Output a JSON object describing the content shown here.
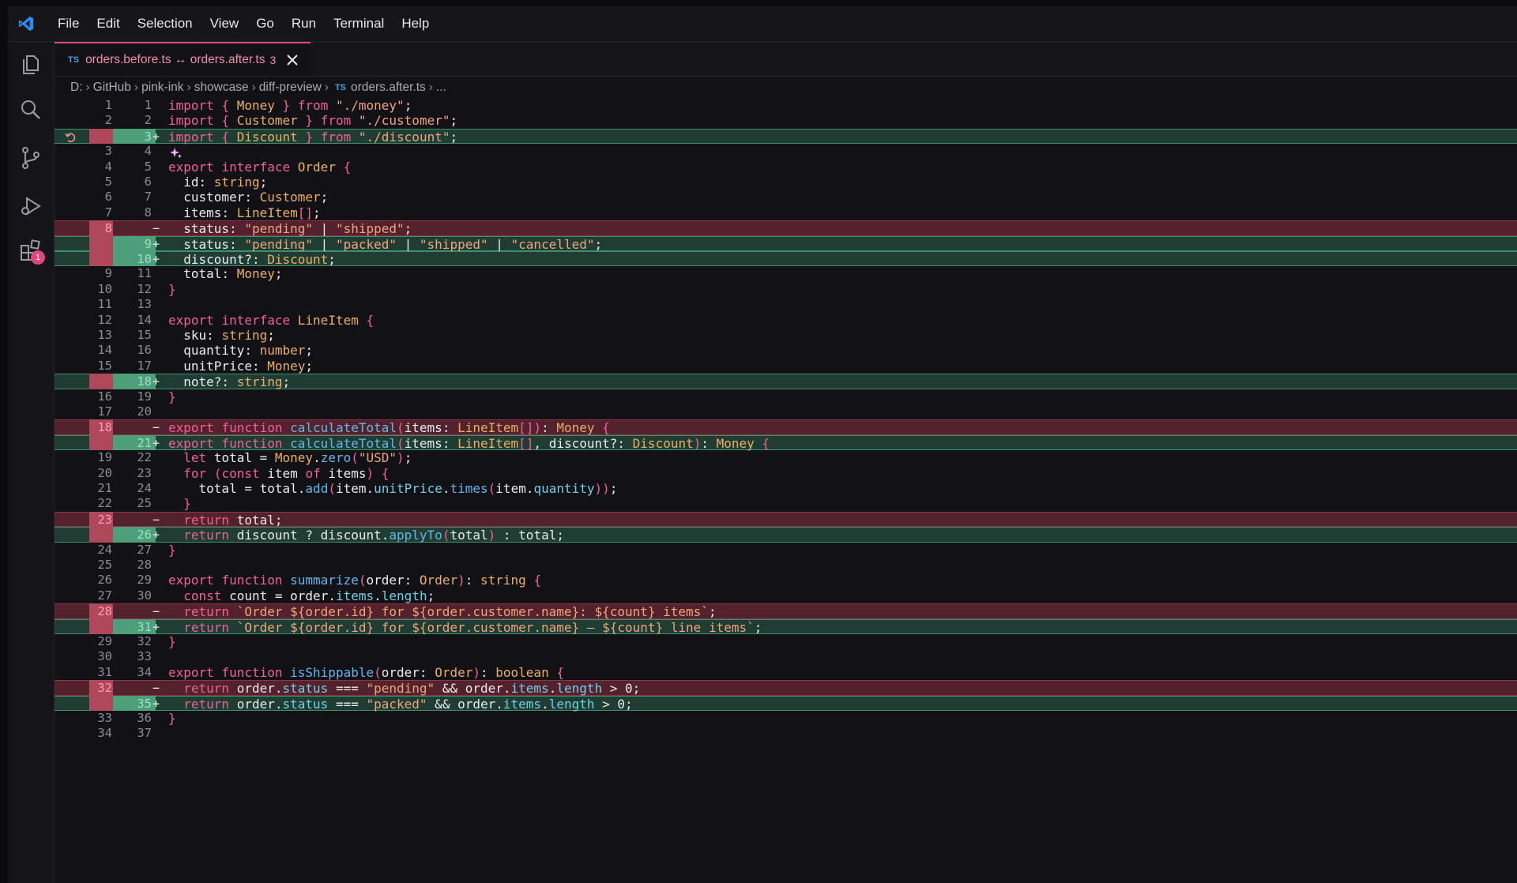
{
  "menu": [
    "File",
    "Edit",
    "Selection",
    "View",
    "Go",
    "Run",
    "Terminal",
    "Help"
  ],
  "tab": {
    "lang": "TS",
    "title": "orders.before.ts ↔ orders.after.ts",
    "count": "3"
  },
  "breadcrumb": {
    "drive": "D:",
    "parts": [
      "GitHub",
      "pink-ink",
      "showcase",
      "diff-preview"
    ],
    "lang": "TS",
    "file": "orders.after.ts",
    "more": "..."
  },
  "activity": {
    "extensions_badge": "1"
  },
  "colors": {
    "accent": "#e0457b",
    "deleted_bg": "#54222c",
    "inserted_bg": "#1f3d33",
    "ts_blue": "#4a9de0"
  },
  "lines": [
    {
      "type": "ctx",
      "old": "1",
      "new": "1",
      "code": "import { Money } from \"./money\";"
    },
    {
      "type": "ctx",
      "old": "2",
      "new": "2",
      "code": "import { Customer } from \"./customer\";"
    },
    {
      "type": "ins",
      "old": "",
      "new": "3",
      "code": "import { Discount } from \"./discount\";"
    },
    {
      "type": "ctx",
      "old": "3",
      "new": "4",
      "code": ""
    },
    {
      "type": "ctx",
      "old": "4",
      "new": "5",
      "code": "export interface Order {"
    },
    {
      "type": "ctx",
      "old": "5",
      "new": "6",
      "code": "  id: string;"
    },
    {
      "type": "ctx",
      "old": "6",
      "new": "7",
      "code": "  customer: Customer;"
    },
    {
      "type": "ctx",
      "old": "7",
      "new": "8",
      "code": "  items: LineItem[];"
    },
    {
      "type": "del",
      "old": "8",
      "new": "",
      "code": "  status: \"pending\" | \"shipped\";"
    },
    {
      "type": "ins",
      "old": "",
      "new": "9",
      "code": "  status: \"pending\" | \"packed\" | \"shipped\" | \"cancelled\";"
    },
    {
      "type": "ins",
      "old": "",
      "new": "10",
      "code": "  discount?: Discount;"
    },
    {
      "type": "ctx",
      "old": "9",
      "new": "11",
      "code": "  total: Money;"
    },
    {
      "type": "ctx",
      "old": "10",
      "new": "12",
      "code": "}"
    },
    {
      "type": "ctx",
      "old": "11",
      "new": "13",
      "code": ""
    },
    {
      "type": "ctx",
      "old": "12",
      "new": "14",
      "code": "export interface LineItem {"
    },
    {
      "type": "ctx",
      "old": "13",
      "new": "15",
      "code": "  sku: string;"
    },
    {
      "type": "ctx",
      "old": "14",
      "new": "16",
      "code": "  quantity: number;"
    },
    {
      "type": "ctx",
      "old": "15",
      "new": "17",
      "code": "  unitPrice: Money;"
    },
    {
      "type": "ins",
      "old": "",
      "new": "18",
      "code": "  note?: string;"
    },
    {
      "type": "ctx",
      "old": "16",
      "new": "19",
      "code": "}"
    },
    {
      "type": "ctx",
      "old": "17",
      "new": "20",
      "code": ""
    },
    {
      "type": "del",
      "old": "18",
      "new": "",
      "code": "export function calculateTotal(items: LineItem[]): Money {"
    },
    {
      "type": "ins",
      "old": "",
      "new": "21",
      "code": "export function calculateTotal(items: LineItem[], discount?: Discount): Money {"
    },
    {
      "type": "ctx",
      "old": "19",
      "new": "22",
      "code": "  let total = Money.zero(\"USD\");"
    },
    {
      "type": "ctx",
      "old": "20",
      "new": "23",
      "code": "  for (const item of items) {"
    },
    {
      "type": "ctx",
      "old": "21",
      "new": "24",
      "code": "    total = total.add(item.unitPrice.times(item.quantity));"
    },
    {
      "type": "ctx",
      "old": "22",
      "new": "25",
      "code": "  }"
    },
    {
      "type": "del",
      "old": "23",
      "new": "",
      "code": "  return total;"
    },
    {
      "type": "ins",
      "old": "",
      "new": "26",
      "code": "  return discount ? discount.applyTo(total) : total;"
    },
    {
      "type": "ctx",
      "old": "24",
      "new": "27",
      "code": "}"
    },
    {
      "type": "ctx",
      "old": "25",
      "new": "28",
      "code": ""
    },
    {
      "type": "ctx",
      "old": "26",
      "new": "29",
      "code": "export function summarize(order: Order): string {"
    },
    {
      "type": "ctx",
      "old": "27",
      "new": "30",
      "code": "  const count = order.items.length;"
    },
    {
      "type": "del",
      "old": "28",
      "new": "",
      "code": "  return `Order ${order.id} for ${order.customer.name}: ${count} items`;"
    },
    {
      "type": "ins",
      "old": "",
      "new": "31",
      "code": "  return `Order ${order.id} for ${order.customer.name} — ${count} line items`;"
    },
    {
      "type": "ctx",
      "old": "29",
      "new": "32",
      "code": "}"
    },
    {
      "type": "ctx",
      "old": "30",
      "new": "33",
      "code": ""
    },
    {
      "type": "ctx",
      "old": "31",
      "new": "34",
      "code": "export function isShippable(order: Order): boolean {"
    },
    {
      "type": "del",
      "old": "32",
      "new": "",
      "code": "  return order.status === \"pending\" && order.items.length > 0;"
    },
    {
      "type": "ins",
      "old": "",
      "new": "35",
      "code": "  return order.status === \"packed\" && order.items.length > 0;"
    },
    {
      "type": "ctx",
      "old": "33",
      "new": "36",
      "code": "}"
    },
    {
      "type": "ctx",
      "old": "34",
      "new": "37",
      "code": ""
    }
  ]
}
